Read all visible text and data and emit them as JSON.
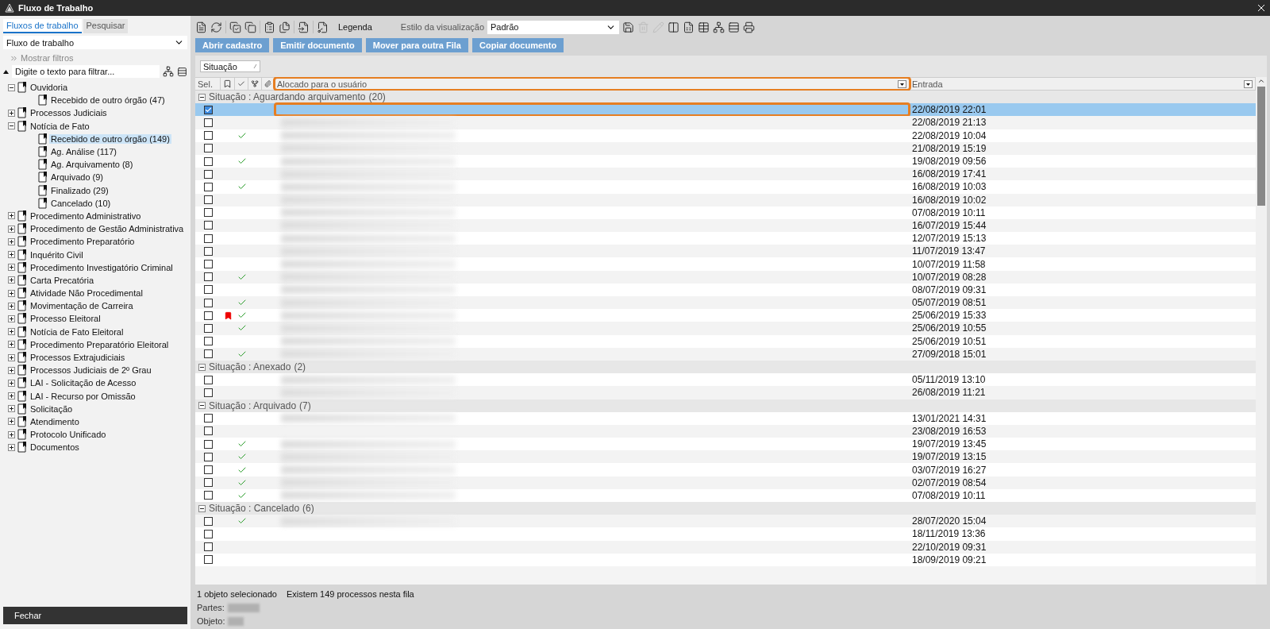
{
  "window": {
    "title": "Fluxo de Trabalho"
  },
  "sidebar": {
    "tabs": [
      {
        "label": "Fluxos de trabalho",
        "selected": true
      },
      {
        "label": "Pesquisar",
        "selected": false
      }
    ],
    "workflow_select": {
      "value": "Fluxo de trabalho"
    },
    "show_filters": "Mostrar filtros",
    "filter": {
      "placeholder": "Digite o texto para filtrar..."
    },
    "tree": [
      {
        "label": "Ouvidoria",
        "expanded": true,
        "selected": false,
        "children": [
          {
            "label": "Recebido de outro órgão (47)",
            "selected": false
          }
        ]
      },
      {
        "label": "Processos Judiciais",
        "expanded": false,
        "selected": false
      },
      {
        "label": "Notícia de Fato",
        "expanded": true,
        "selected": false,
        "children": [
          {
            "label": "Recebido de outro órgão (149)",
            "selected": true
          },
          {
            "label": "Ag. Análise (117)",
            "selected": false
          },
          {
            "label": "Ag. Arquivamento (8)",
            "selected": false
          },
          {
            "label": "Arquivado (9)",
            "selected": false
          },
          {
            "label": "Finalizado (29)",
            "selected": false
          },
          {
            "label": "Cancelado (10)",
            "selected": false
          }
        ]
      },
      {
        "label": "Procedimento Administrativo",
        "expanded": false,
        "selected": false
      },
      {
        "label": "Procedimento de Gestão Administrativa",
        "expanded": false,
        "selected": false
      },
      {
        "label": "Procedimento Preparatório",
        "expanded": false,
        "selected": false
      },
      {
        "label": "Inquérito Civil",
        "expanded": false,
        "selected": false
      },
      {
        "label": "Procedimento Investigatório Criminal",
        "expanded": false,
        "selected": false
      },
      {
        "label": "Carta Precatória",
        "expanded": false,
        "selected": false
      },
      {
        "label": "Atividade Não Procedimental",
        "expanded": false,
        "selected": false
      },
      {
        "label": "Movimentação de Carreira",
        "expanded": false,
        "selected": false
      },
      {
        "label": "Processo Eleitoral",
        "expanded": false,
        "selected": false
      },
      {
        "label": "Notícia de Fato Eleitoral",
        "expanded": false,
        "selected": false
      },
      {
        "label": "Procedimento Preparatório Eleitoral",
        "expanded": false,
        "selected": false
      },
      {
        "label": "Processos Extrajudiciais",
        "expanded": false,
        "selected": false
      },
      {
        "label": "Processos Judiciais de 2º Grau",
        "expanded": false,
        "selected": false
      },
      {
        "label": "LAI - Solicitação de Acesso",
        "expanded": false,
        "selected": false
      },
      {
        "label": "LAI - Recurso por Omissão",
        "expanded": false,
        "selected": false
      },
      {
        "label": "Solicitação",
        "expanded": false,
        "selected": false
      },
      {
        "label": "Atendimento",
        "expanded": false,
        "selected": false
      },
      {
        "label": "Protocolo Unificado",
        "expanded": false,
        "selected": false
      },
      {
        "label": "Documentos",
        "expanded": false,
        "selected": false
      }
    ],
    "close_button": "Fechar"
  },
  "toolbar": {
    "icons": [
      {
        "kind": "page",
        "disabled": false
      },
      {
        "kind": "refresh",
        "disabled": false
      },
      {
        "kind": "copy-check",
        "disabled": false
      },
      {
        "kind": "copy",
        "disabled": false
      },
      {
        "kind": "clipboard",
        "disabled": false
      },
      {
        "kind": "files",
        "disabled": false
      },
      {
        "kind": "file-arrow",
        "disabled": false
      },
      {
        "kind": "file-key",
        "disabled": false
      }
    ],
    "legend": "Legenda",
    "style_label": "Estilo da visualização",
    "style_value": "Padrão",
    "right_icons": [
      {
        "kind": "save",
        "disabled": false
      },
      {
        "kind": "trash",
        "disabled": true
      },
      {
        "kind": "pencil",
        "disabled": true
      },
      {
        "kind": "columns",
        "disabled": false
      },
      {
        "kind": "document",
        "disabled": false
      },
      {
        "kind": "table",
        "disabled": false
      },
      {
        "kind": "tree",
        "disabled": false
      },
      {
        "kind": "rows",
        "disabled": false
      },
      {
        "kind": "printer",
        "disabled": false
      }
    ]
  },
  "actions": [
    "Abrir cadastro",
    "Emitir documento",
    "Mover para outra Fila",
    "Copiar documento"
  ],
  "group_by": {
    "label": "Situação"
  },
  "table": {
    "columns": [
      {
        "label": "Sel.",
        "kind": "text",
        "highlighted": false
      },
      {
        "kind": "bookmark",
        "highlighted": false
      },
      {
        "kind": "check",
        "highlighted": false
      },
      {
        "kind": "tree",
        "highlighted": false
      },
      {
        "kind": "clip",
        "highlighted": false
      },
      {
        "label": "Alocado para o usuário",
        "kind": "filter",
        "highlighted": true
      },
      {
        "label": "Entrada",
        "kind": "filter",
        "highlighted": false
      }
    ],
    "groups": [
      {
        "label": "Situação : Aguardando arquivamento",
        "count": "(20)",
        "expanded": true,
        "rows": [
          {
            "entrada": "22/08/2019 22:01",
            "checked": true,
            "selected": true,
            "done": false,
            "flagged": false,
            "blurred": false
          },
          {
            "entrada": "22/08/2019 21:13",
            "checked": false,
            "selected": false,
            "done": false,
            "flagged": false,
            "blurred": true
          },
          {
            "entrada": "22/08/2019 10:04",
            "checked": false,
            "selected": false,
            "done": true,
            "flagged": false,
            "blurred": true
          },
          {
            "entrada": "21/08/2019 15:19",
            "checked": false,
            "selected": false,
            "done": false,
            "flagged": false,
            "blurred": true
          },
          {
            "entrada": "19/08/2019 09:56",
            "checked": false,
            "selected": false,
            "done": true,
            "flagged": false,
            "blurred": true
          },
          {
            "entrada": "16/08/2019 17:41",
            "checked": false,
            "selected": false,
            "done": false,
            "flagged": false,
            "blurred": true
          },
          {
            "entrada": "16/08/2019 10:03",
            "checked": false,
            "selected": false,
            "done": true,
            "flagged": false,
            "blurred": true
          },
          {
            "entrada": "16/08/2019 10:02",
            "checked": false,
            "selected": false,
            "done": false,
            "flagged": false,
            "blurred": true
          },
          {
            "entrada": "07/08/2019 10:11",
            "checked": false,
            "selected": false,
            "done": false,
            "flagged": false,
            "blurred": true
          },
          {
            "entrada": "16/07/2019 15:44",
            "checked": false,
            "selected": false,
            "done": false,
            "flagged": false,
            "blurred": true
          },
          {
            "entrada": "12/07/2019 15:13",
            "checked": false,
            "selected": false,
            "done": false,
            "flagged": false,
            "blurred": true
          },
          {
            "entrada": "11/07/2019 13:47",
            "checked": false,
            "selected": false,
            "done": false,
            "flagged": false,
            "blurred": true
          },
          {
            "entrada": "10/07/2019 11:58",
            "checked": false,
            "selected": false,
            "done": false,
            "flagged": false,
            "blurred": true
          },
          {
            "entrada": "10/07/2019 08:28",
            "checked": false,
            "selected": false,
            "done": true,
            "flagged": false,
            "blurred": true
          },
          {
            "entrada": "08/07/2019 09:31",
            "checked": false,
            "selected": false,
            "done": false,
            "flagged": false,
            "blurred": true
          },
          {
            "entrada": "05/07/2019 08:51",
            "checked": false,
            "selected": false,
            "done": true,
            "flagged": false,
            "blurred": true
          },
          {
            "entrada": "25/06/2019 15:33",
            "checked": false,
            "selected": false,
            "done": true,
            "flagged": true,
            "blurred": true
          },
          {
            "entrada": "25/06/2019 10:55",
            "checked": false,
            "selected": false,
            "done": true,
            "flagged": false,
            "blurred": true
          },
          {
            "entrada": "25/06/2019 10:51",
            "checked": false,
            "selected": false,
            "done": false,
            "flagged": false,
            "blurred": true
          },
          {
            "entrada": "27/09/2018 15:01",
            "checked": false,
            "selected": false,
            "done": true,
            "flagged": false,
            "blurred": true
          }
        ]
      },
      {
        "label": "Situação : Anexado",
        "count": "(2)",
        "expanded": true,
        "rows": [
          {
            "entrada": "05/11/2019 13:10",
            "checked": false,
            "selected": false,
            "done": false,
            "flagged": false,
            "blurred": true
          },
          {
            "entrada": "26/08/2019 11:21",
            "checked": false,
            "selected": false,
            "done": false,
            "flagged": false,
            "blurred": true
          }
        ]
      },
      {
        "label": "Situação : Arquivado",
        "count": "(7)",
        "expanded": true,
        "rows": [
          {
            "entrada": "13/01/2021 14:31",
            "checked": false,
            "selected": false,
            "done": false,
            "flagged": false,
            "blurred": true
          },
          {
            "entrada": "23/08/2019 16:53",
            "checked": false,
            "selected": false,
            "done": false,
            "flagged": false,
            "blurred": false
          },
          {
            "entrada": "19/07/2019 13:45",
            "checked": false,
            "selected": false,
            "done": true,
            "flagged": false,
            "blurred": true
          },
          {
            "entrada": "19/07/2019 13:15",
            "checked": false,
            "selected": false,
            "done": true,
            "flagged": false,
            "blurred": true
          },
          {
            "entrada": "03/07/2019 16:27",
            "checked": false,
            "selected": false,
            "done": true,
            "flagged": false,
            "blurred": true
          },
          {
            "entrada": "02/07/2019 08:54",
            "checked": false,
            "selected": false,
            "done": true,
            "flagged": false,
            "blurred": true
          },
          {
            "entrada": "07/08/2019 10:11",
            "checked": false,
            "selected": false,
            "done": true,
            "flagged": false,
            "blurred": true
          }
        ]
      },
      {
        "label": "Situação : Cancelado",
        "count": "(6)",
        "expanded": true,
        "rows": [
          {
            "entrada": "28/07/2020 15:04",
            "checked": false,
            "selected": false,
            "done": true,
            "flagged": false,
            "blurred": true
          },
          {
            "entrada": "18/11/2019 13:36",
            "checked": false,
            "selected": false,
            "done": false,
            "flagged": false,
            "blurred": false
          },
          {
            "entrada": "22/10/2019 09:31",
            "checked": false,
            "selected": false,
            "done": false,
            "flagged": false,
            "blurred": false
          },
          {
            "entrada": "18/09/2019 09:21",
            "checked": false,
            "selected": false,
            "done": false,
            "flagged": false,
            "blurred": false
          }
        ]
      }
    ]
  },
  "status_bar": {
    "selection": "1 objeto selecionado",
    "count": "Existem 149 processos nesta fila",
    "details": [
      {
        "label": "Partes:"
      },
      {
        "label": "Objeto:"
      }
    ]
  }
}
